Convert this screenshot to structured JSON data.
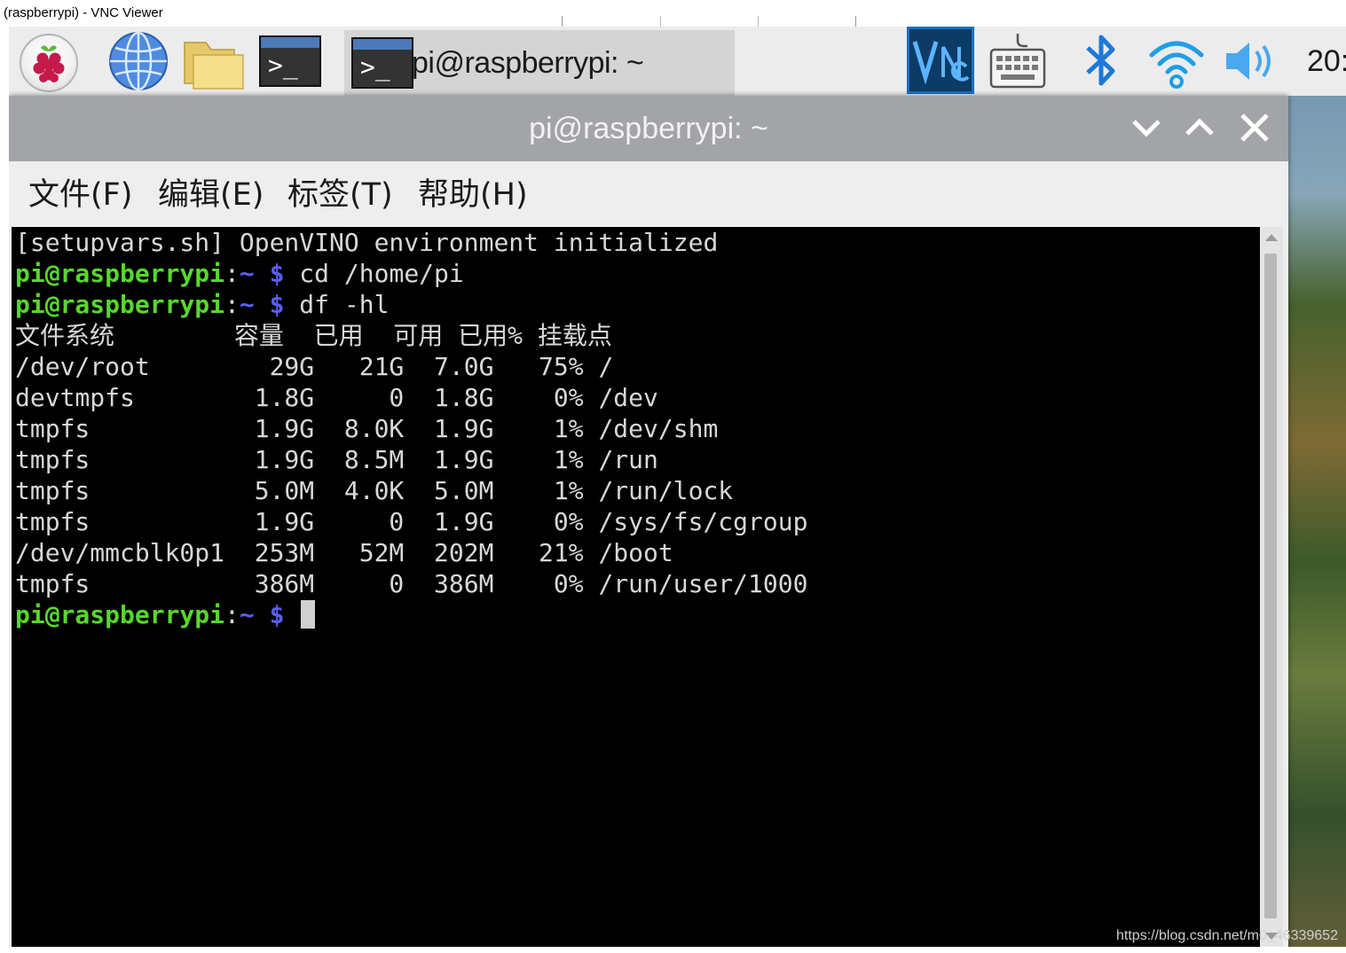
{
  "vnc_window": {
    "title": "(raspberrypi) - VNC Viewer"
  },
  "taskbar": {
    "launchers": [
      {
        "name": "raspberry-menu",
        "icon": "raspberry-icon"
      },
      {
        "name": "web-browser",
        "icon": "globe-icon"
      },
      {
        "name": "file-manager",
        "icon": "folder-icon"
      },
      {
        "name": "terminal",
        "icon": "terminal-icon"
      }
    ],
    "task_window_label": "pi@raspberrypi: ~",
    "clock": "20:"
  },
  "terminal": {
    "title": "pi@raspberrypi: ~",
    "menu": {
      "file": "文件(F)",
      "edit": "编辑(E)",
      "tabs": "标签(T)",
      "help": "帮助(H)"
    },
    "lines": {
      "init": "[setupvars.sh] OpenVINO environment initialized",
      "prompt_user": "pi@raspberrypi",
      "prompt_colon": ":",
      "prompt_path": "~ $",
      "cmd1": " cd /home/pi",
      "cmd2": " df -hl",
      "df_header": "文件系统        容量  已用  可用 已用% 挂载点",
      "df_rows": [
        "/dev/root        29G   21G  7.0G   75% /",
        "devtmpfs        1.8G     0  1.8G    0% /dev",
        "tmpfs           1.9G  8.0K  1.9G    1% /dev/shm",
        "tmpfs           1.9G  8.5M  1.9G    1% /run",
        "tmpfs           5.0M  4.0K  5.0M    1% /run/lock",
        "tmpfs           1.9G     0  1.9G    0% /sys/fs/cgroup",
        "/dev/mmcblk0p1  253M   52M  202M   21% /boot",
        "tmpfs           386M     0  386M    0% /run/user/1000"
      ]
    }
  },
  "watermark": "https://blog.csdn.net/m0_46339652",
  "colors": {
    "prompt_user": "#57d72d",
    "prompt_path": "#5a5ef5",
    "terminal_bg": "#000000",
    "titlebar": "#a2a4a8",
    "vnc_accent": "#1e6fc0"
  }
}
